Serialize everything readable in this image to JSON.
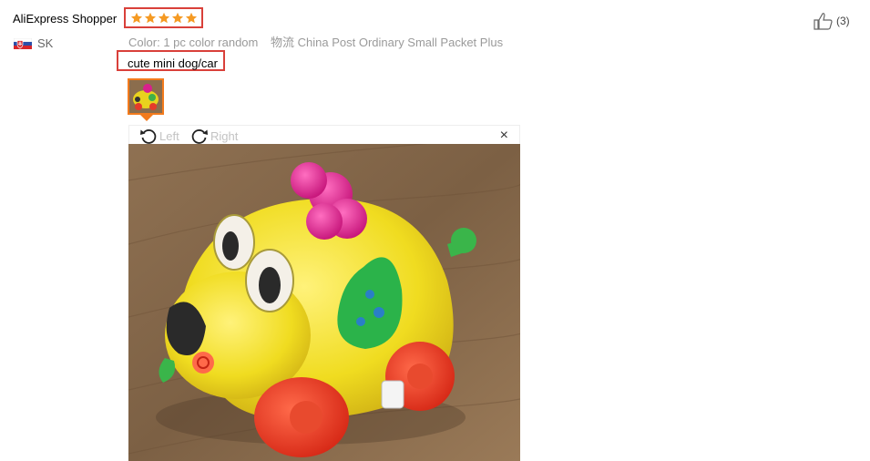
{
  "review": {
    "reviewer_name": "AliExpress Shopper",
    "country_code": "SK",
    "rating": 5,
    "color_label": "Color:",
    "color_value": "1 pc color random",
    "logistics_label": "物流",
    "logistics_value": "China Post Ordinary Small Packet Plus",
    "comment": "cute mini dog/car",
    "likes": "(3)"
  },
  "viewer": {
    "rotate_left_label": "Left",
    "rotate_right_label": "Right",
    "close_label": "×"
  },
  "icons": {
    "flag": "slovakia-flag-icon",
    "star": "star-icon",
    "like": "thumbs-up-icon",
    "rotate_left": "rotate-left-icon",
    "rotate_right": "rotate-right-icon",
    "close": "close-icon"
  },
  "colors": {
    "star": "#f59a23",
    "highlight_border": "#d9403a",
    "thumb_border": "#f37b1d"
  }
}
